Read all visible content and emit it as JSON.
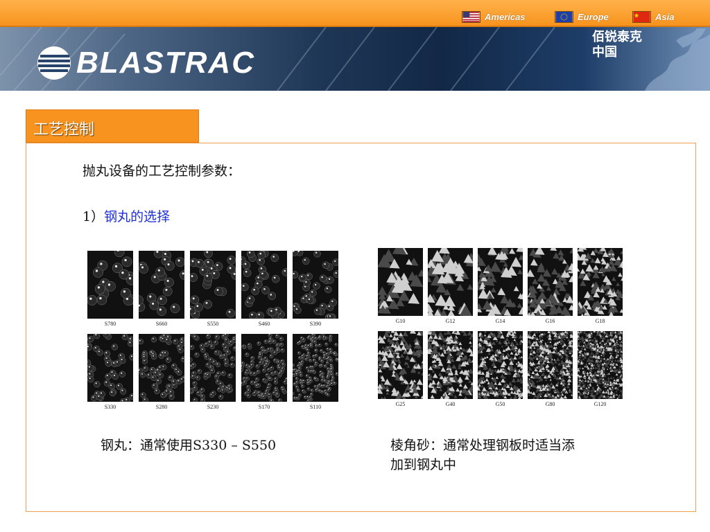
{
  "header": {
    "regions": [
      {
        "label": "Americas",
        "flag_icon": "us-flag-icon"
      },
      {
        "label": "Europe",
        "flag_icon": "eu-flag-icon"
      },
      {
        "label": "Asia",
        "flag_icon": "china-flag-icon"
      }
    ],
    "logo_text": "BLASTRAC",
    "cn_name_line1": "佰锐泰克",
    "cn_name_line2": "中国"
  },
  "section": {
    "tab_title": "工艺控制",
    "intro": "抛丸设备的工艺控制参数：",
    "item_number": "1）",
    "item_title": "钢丸的选择"
  },
  "shot_grid": {
    "row1": [
      "S780",
      "S660",
      "S550",
      "S460",
      "S390"
    ],
    "row2": [
      "S330",
      "S280",
      "S230",
      "S170",
      "S110"
    ]
  },
  "grit_grid": {
    "row1": [
      "G10",
      "G12",
      "G14",
      "G16",
      "G18"
    ],
    "row2": [
      "G25",
      "G40",
      "G50",
      "G80",
      "G120"
    ]
  },
  "captions": {
    "shot": "钢丸：通常使用S330 – S550",
    "grit_line1": "棱角砂：通常处理钢板时适当添",
    "grit_line2": "加到钢丸中"
  },
  "colors": {
    "accent_orange": "#f7931e",
    "link_blue": "#1f2fd6",
    "banner_navy": "#122846"
  }
}
